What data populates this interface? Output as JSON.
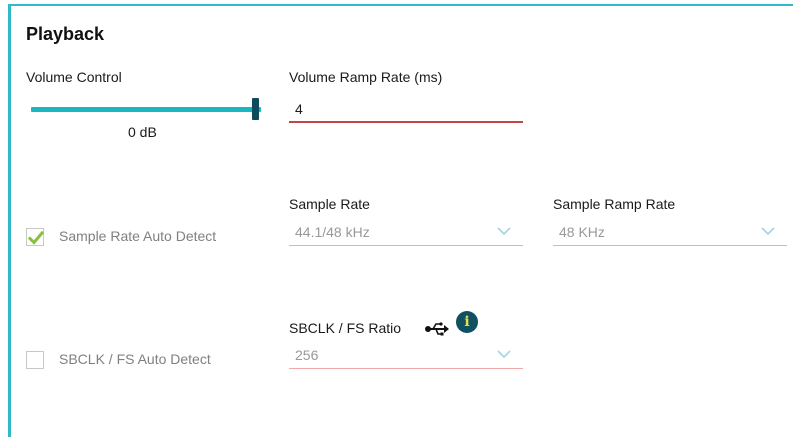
{
  "panel": {
    "title": "Playback"
  },
  "volume": {
    "label": "Volume Control",
    "value_text": "0 dB",
    "level": 1.0
  },
  "ramp_rate": {
    "label": "Volume Ramp Rate (ms)",
    "value": "4"
  },
  "sample_rate_auto": {
    "label": "Sample Rate Auto Detect",
    "checked": true
  },
  "sample_rate": {
    "label": "Sample Rate",
    "value": "44.1/48 kHz"
  },
  "sample_ramp_rate": {
    "label": "Sample Ramp Rate",
    "value": "48 KHz"
  },
  "sbclk_auto": {
    "label": "SBCLK / FS Auto Detect",
    "checked": false
  },
  "sbclk_ratio": {
    "label": "SBCLK / FS Ratio",
    "value": "256",
    "info_icon": "i"
  },
  "colors": {
    "accent": "#1ab6c1",
    "thumb": "#0c4a5e",
    "underline": "#c44646",
    "check": "#8bbf3f"
  },
  "icons": [
    "usb-icon",
    "info-icon",
    "chevron-down-icon",
    "checkmark-icon"
  ]
}
